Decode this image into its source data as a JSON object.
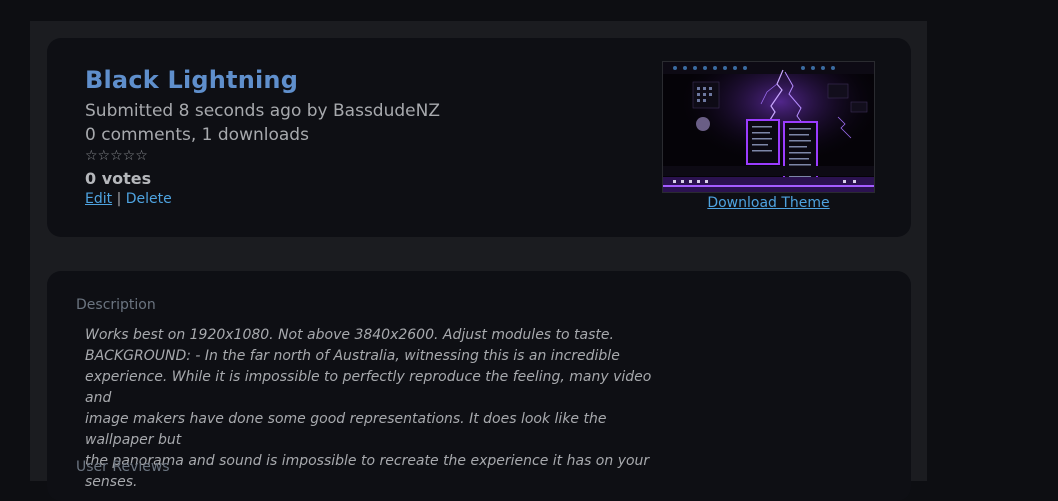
{
  "theme": {
    "title": "Black Lightning",
    "submitted": "Submitted 8 seconds ago by BassdudeNZ",
    "stats": "0 comments, 1 downloads",
    "rating_stars": "☆☆☆☆☆",
    "rating_value": 0,
    "votes": "0 votes",
    "edit_label": "Edit",
    "separator": "|",
    "delete_label": "Delete",
    "download_label": "Download Theme"
  },
  "description": {
    "label": "Description",
    "lines": [
      "Works best on 1920x1080. Not above 3840x2600. Adjust modules to taste.",
      "BACKGROUND: - In the far north of Australia, witnessing this is an incredible",
      "experience. While it is impossible to perfectly reproduce the feeling, many video and",
      "image makers have done some good representations. It does look like the wallpaper but",
      "the panorama and sound is impossible to recreate the experience it has on your senses."
    ]
  },
  "reviews": {
    "label": "User Reviews"
  },
  "colors": {
    "accent_title": "#5f8fcc",
    "link": "#4ea3e0",
    "lightning": "#8a3cff"
  }
}
